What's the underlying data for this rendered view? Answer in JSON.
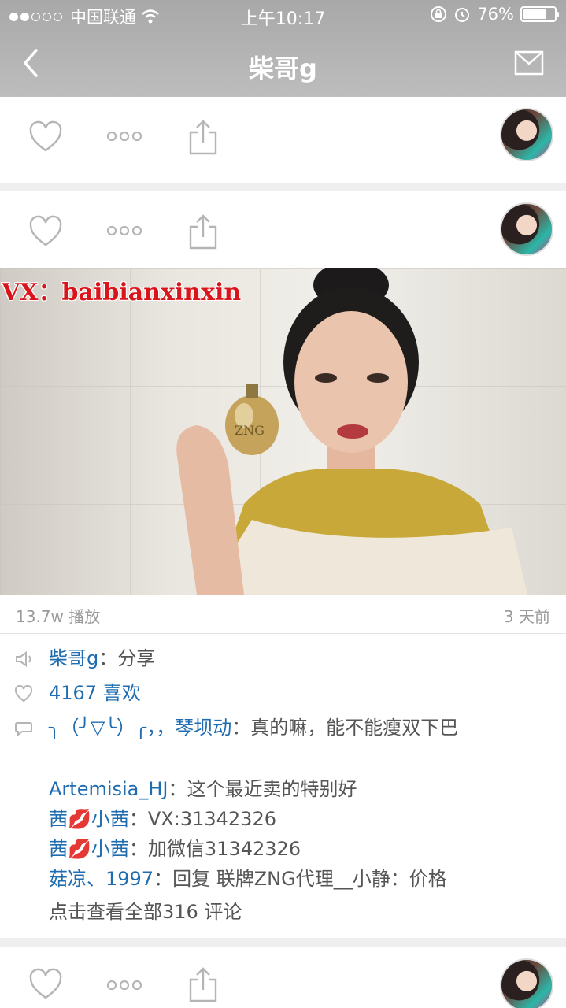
{
  "status_bar": {
    "carrier": "中国联通",
    "time": "上午10:17",
    "battery_percent": "76%",
    "battery_level": 0.76
  },
  "nav": {
    "title": "柴哥g"
  },
  "post": {
    "watermark": "VX：baibianxinxin",
    "plays": "13.7w 播放",
    "time_ago": "3 天前",
    "author": "柴哥g",
    "author_sep": "：分享",
    "likes": "4167 喜欢",
    "comments": [
      {
        "user": "╮（╯▽╰）╭，，琴坝动",
        "text": "：真的嘛，能不能瘦双下巴"
      },
      {
        "user": "Artemisia_HJ",
        "text": "：这个最近卖的特别好"
      },
      {
        "user": "茜💋小茜",
        "text": "：VX:31342326"
      },
      {
        "user": "茜💋小茜",
        "text": "：加微信31342326"
      },
      {
        "user": "菇凉、1997",
        "text": "：回复 联牌ZNG代理__小静：价格"
      }
    ],
    "view_all": "点击查看全部316 评论"
  },
  "icons": {
    "heart": "heart-icon",
    "more": "more-dots-icon",
    "share": "share-icon",
    "back": "back-chevron-icon",
    "mail": "mail-icon",
    "speaker": "speaker-icon",
    "comment": "comment-icon"
  }
}
